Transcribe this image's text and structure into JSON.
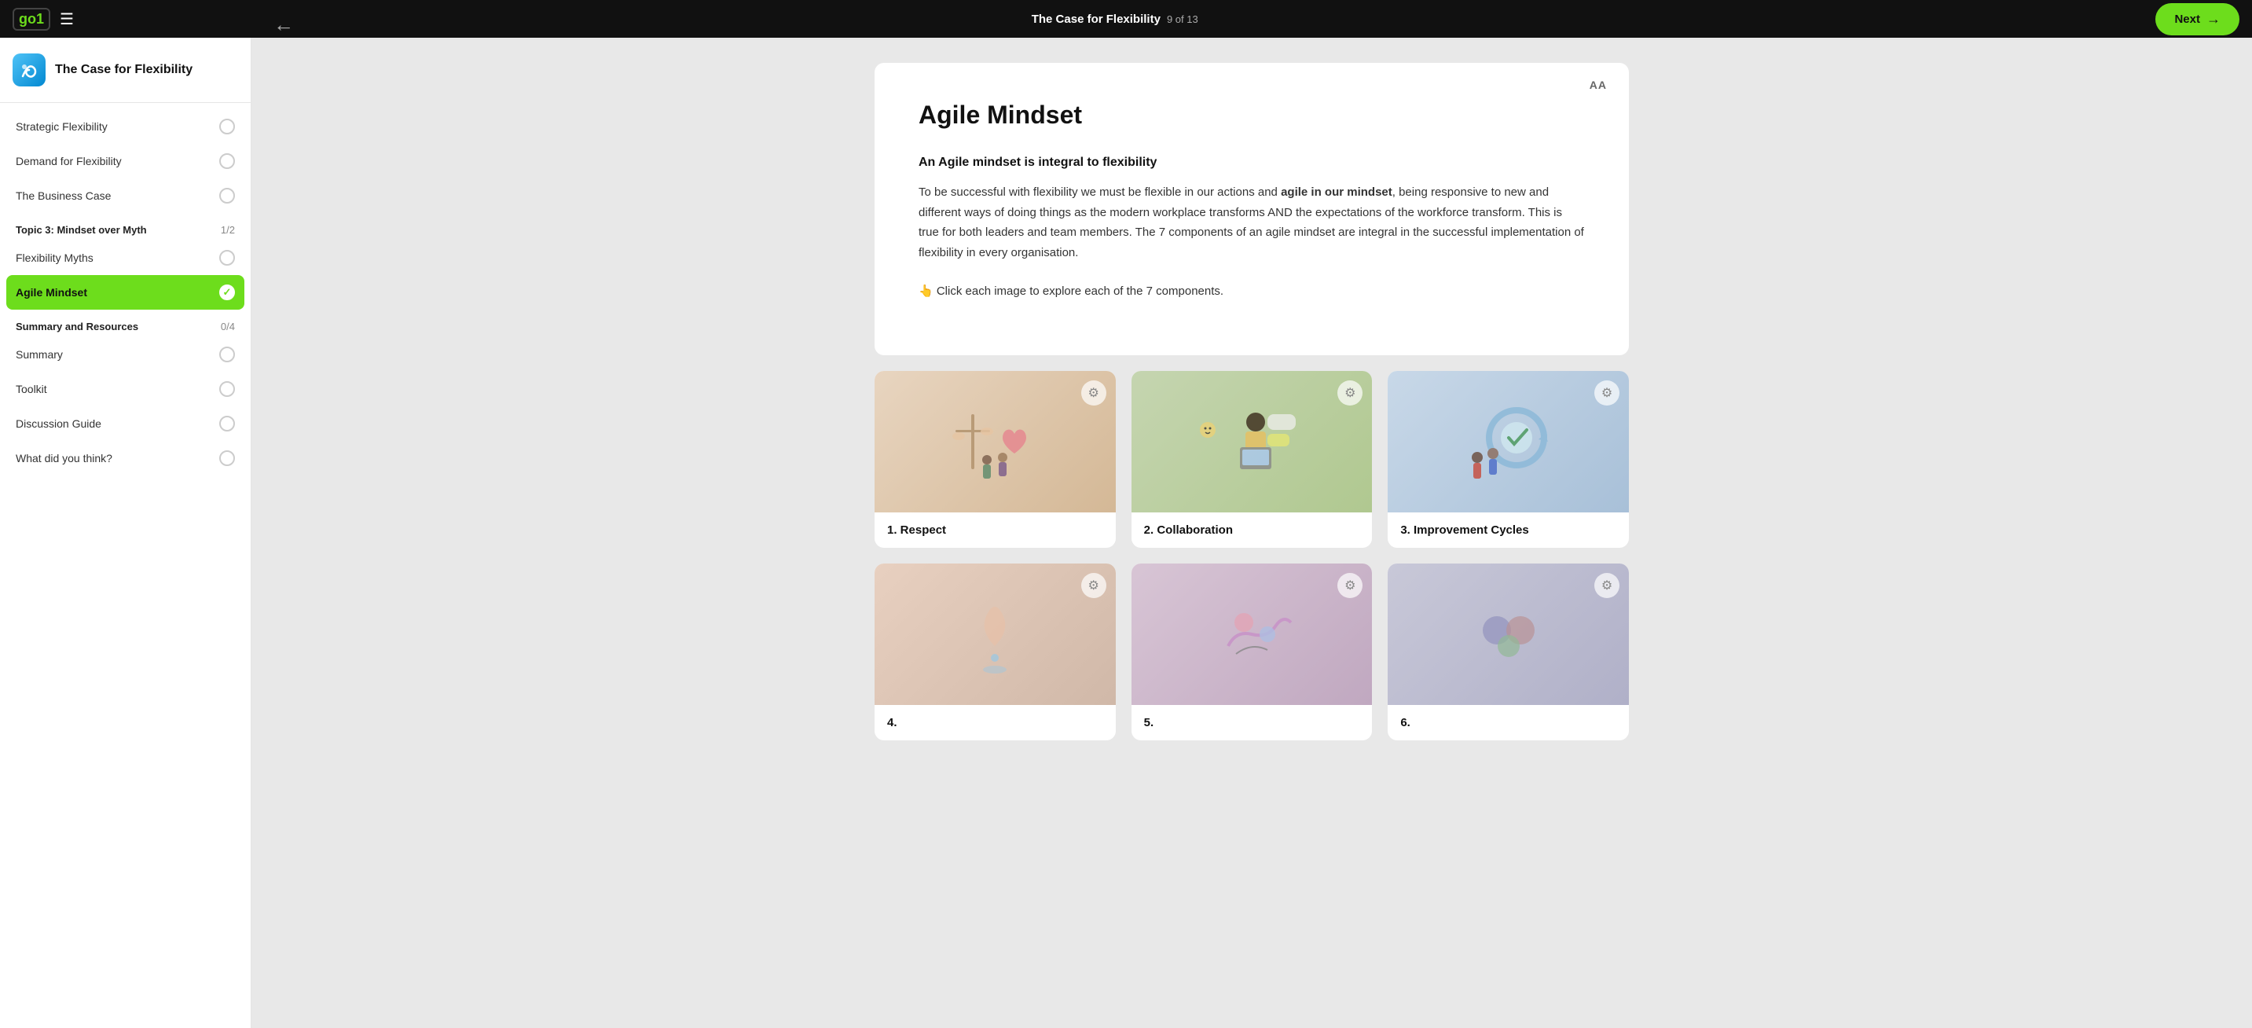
{
  "topbar": {
    "logo": "go1",
    "course_title": "The Case for Flexibility",
    "progress": "9 of 13",
    "next_label": "Next"
  },
  "sidebar": {
    "course_title": "The Case for Flexibility",
    "items_topic2": [
      {
        "id": "strategic-flexibility",
        "label": "Strategic Flexibility"
      },
      {
        "id": "demand-for-flexibility",
        "label": "Demand for Flexibility"
      },
      {
        "id": "the-business-case",
        "label": "The Business Case"
      }
    ],
    "topic3": {
      "label": "Topic 3: Mindset over Myth",
      "count": "1/2"
    },
    "items_topic3": [
      {
        "id": "flexibility-myths",
        "label": "Flexibility Myths"
      },
      {
        "id": "agile-mindset",
        "label": "Agile Mindset",
        "active": true
      }
    ],
    "summary_section": {
      "label": "Summary and Resources",
      "count": "0/4"
    },
    "items_summary": [
      {
        "id": "summary",
        "label": "Summary"
      },
      {
        "id": "toolkit",
        "label": "Toolkit"
      },
      {
        "id": "discussion-guide",
        "label": "Discussion Guide"
      },
      {
        "id": "what-did-you-think",
        "label": "What did you think?"
      }
    ]
  },
  "content": {
    "font_size_label": "AA",
    "title": "Agile Mindset",
    "subtitle": "An Agile mindset is integral to flexibility",
    "paragraph1_start": "To be successful with flexibility we must be flexible in our actions and ",
    "paragraph1_bold": "agile in our mindset",
    "paragraph1_end": ", being responsive to new and different ways of doing things as the modern workplace transforms AND the expectations of the workforce transform. This is true for both leaders and team members. The 7 components of an agile mindset are integral in the successful implementation of flexibility in every organisation.",
    "click_hint": "👆 Click each image to explore each of the 7 components.",
    "cards": [
      {
        "id": 1,
        "label": "1. Respect",
        "bg": "card-bg-1"
      },
      {
        "id": 2,
        "label": "2. Collaboration",
        "bg": "card-bg-2"
      },
      {
        "id": 3,
        "label": "3. Improvement Cycles",
        "bg": "card-bg-3"
      },
      {
        "id": 4,
        "label": "4.",
        "bg": "card-bg-4"
      },
      {
        "id": 5,
        "label": "5.",
        "bg": "card-bg-5"
      },
      {
        "id": 6,
        "label": "6.",
        "bg": "card-bg-6"
      }
    ],
    "lock_icon": "⚙"
  }
}
